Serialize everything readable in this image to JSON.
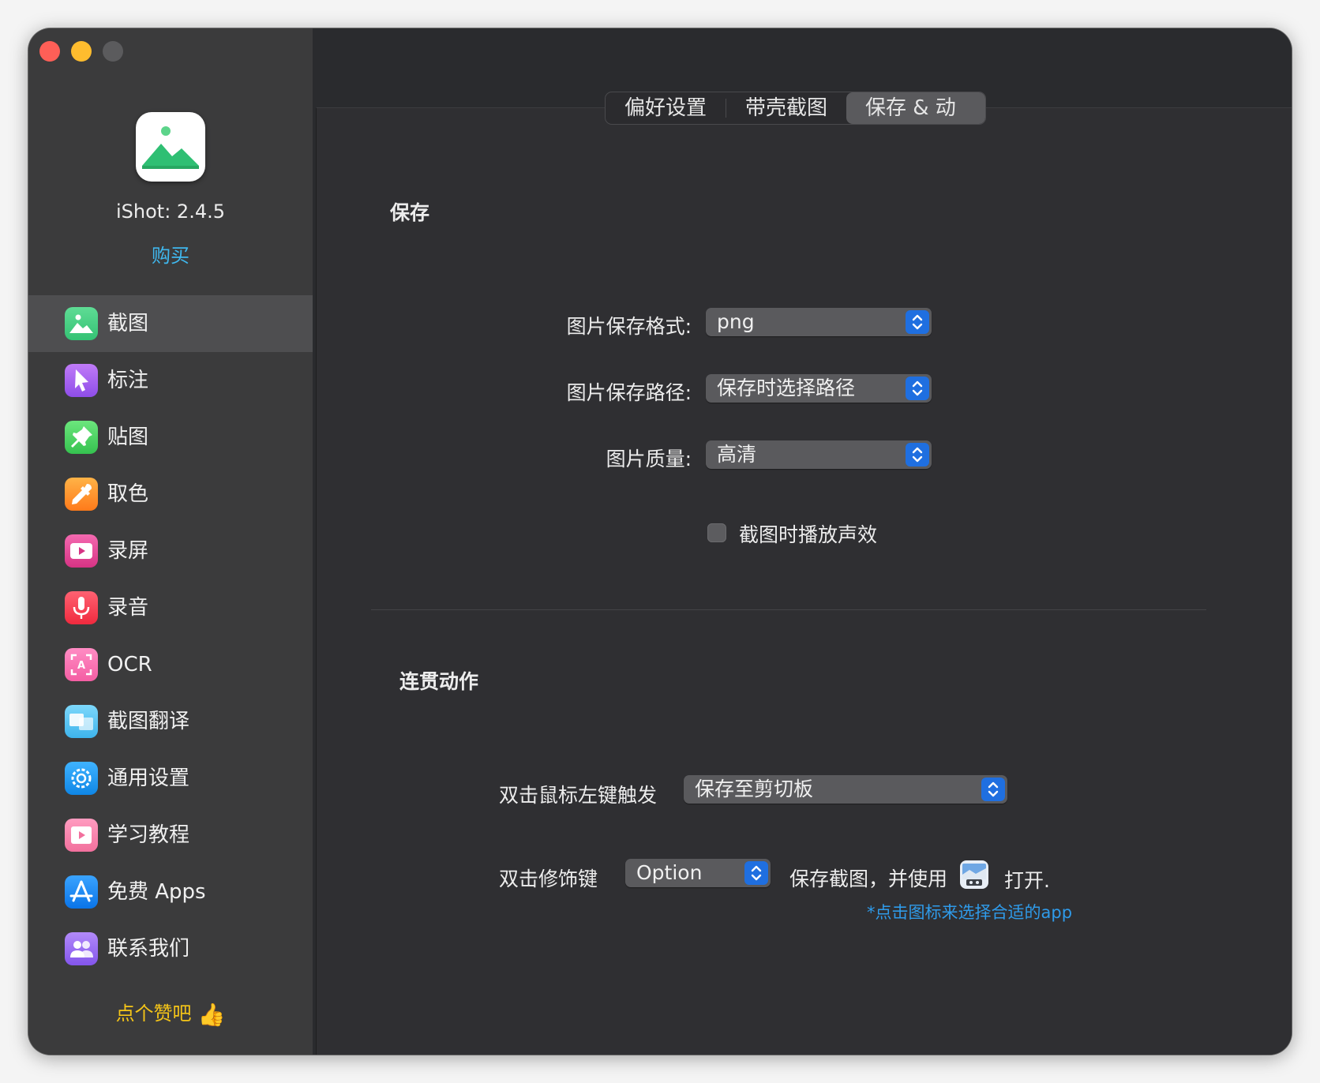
{
  "app": {
    "version_text": "iShot: 2.4.5",
    "buy_label": "购买",
    "like_text": "点个赞吧",
    "like_emoji": "👍"
  },
  "sidebar": {
    "items": [
      {
        "label": "截图",
        "icon": "screenshot-icon",
        "color": "#3ecf7b",
        "active": true
      },
      {
        "label": "标注",
        "icon": "cursor-icon",
        "color": "#a561f2"
      },
      {
        "label": "贴图",
        "icon": "pin-icon",
        "color": "#4cd964"
      },
      {
        "label": "取色",
        "icon": "eyedropper-icon",
        "color": "#ff9b22"
      },
      {
        "label": "录屏",
        "icon": "screen-record-icon",
        "color": "#e8459a"
      },
      {
        "label": "录音",
        "icon": "microphone-icon",
        "color": "#ff3b4f"
      },
      {
        "label": "OCR",
        "icon": "ocr-icon",
        "color": "#ff6fb0"
      },
      {
        "label": "截图翻译",
        "icon": "translate-icon",
        "color": "#5ac8fa"
      },
      {
        "label": "通用设置",
        "icon": "gear-icon",
        "color": "#1e9bf0"
      },
      {
        "label": "学习教程",
        "icon": "tutorial-icon",
        "color": "#ff7aa8"
      },
      {
        "label": "免费 Apps",
        "icon": "app-store-icon",
        "color": "#1a8cff"
      },
      {
        "label": "联系我们",
        "icon": "contacts-icon",
        "color": "#9b6cf5"
      }
    ]
  },
  "tabs": [
    {
      "label": "偏好设置"
    },
    {
      "label": "带壳截图"
    },
    {
      "label": "保存 & 动作",
      "selected": true
    }
  ],
  "save": {
    "title": "保存",
    "format_label": "图片保存格式:",
    "format_value": "png",
    "path_label": "图片保存路径:",
    "path_value": "保存时选择路径",
    "quality_label": "图片质量:",
    "quality_value": "高清",
    "sound_label": "截图时播放声效",
    "sound_checked": false
  },
  "actions": {
    "title": "连贯动作",
    "double_click_label": "双击鼠标左键触发",
    "double_click_value": "保存至剪切板",
    "modifier_label": "双击修饰键",
    "modifier_value": "Option",
    "save_open_text": "保存截图，并使用",
    "open_text": "打开.",
    "hint_text": "*点击图标来选择合适的app"
  },
  "colors": {
    "accent": "#1f6fe0",
    "link": "#3fb8ef",
    "like": "#f5c518"
  }
}
